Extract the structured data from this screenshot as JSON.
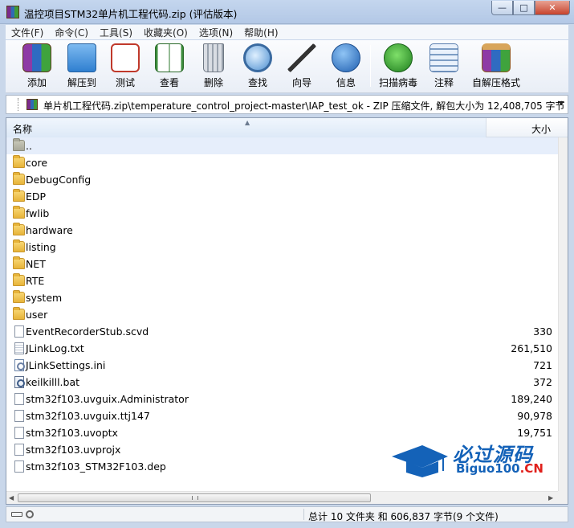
{
  "window": {
    "title": "温控项目STM32单片机工程代码.zip (评估版本)",
    "min_glyph": "—",
    "max_glyph": "□",
    "close_glyph": "✕"
  },
  "menu": [
    "文件(F)",
    "命令(C)",
    "工具(S)",
    "收藏夹(O)",
    "选项(N)",
    "帮助(H)"
  ],
  "toolbar": [
    {
      "label": "添加",
      "icon": "archive-add-icon"
    },
    {
      "label": "解压到",
      "icon": "extract-folder-icon"
    },
    {
      "label": "测试",
      "icon": "test-checklist-icon"
    },
    {
      "label": "查看",
      "icon": "view-book-icon"
    },
    {
      "label": "删除",
      "icon": "trash-icon"
    },
    {
      "label": "查找",
      "icon": "find-magnifier-icon"
    },
    {
      "label": "向导",
      "icon": "wizard-wand-icon"
    },
    {
      "label": "信息",
      "icon": "info-icon"
    },
    {
      "label": "扫描病毒",
      "icon": "virus-scan-bug-icon"
    },
    {
      "label": "注释",
      "icon": "comment-icon"
    },
    {
      "label": "自解压格式",
      "icon": "sfx-box-icon"
    }
  ],
  "address": {
    "path": "单片机工程代码.zip\\temperature_control_project-master\\IAP_test_ok - ZIP 压缩文件, 解包大小为 12,408,705 字节"
  },
  "columns": {
    "name": "名称",
    "size": "大小"
  },
  "files": [
    {
      "name": "..",
      "size": "",
      "type": "up"
    },
    {
      "name": "core",
      "size": "",
      "type": "folder"
    },
    {
      "name": "DebugConfig",
      "size": "",
      "type": "folder"
    },
    {
      "name": "EDP",
      "size": "",
      "type": "folder"
    },
    {
      "name": "fwlib",
      "size": "",
      "type": "folder"
    },
    {
      "name": "hardware",
      "size": "",
      "type": "folder"
    },
    {
      "name": "listing",
      "size": "",
      "type": "folder"
    },
    {
      "name": "NET",
      "size": "",
      "type": "folder"
    },
    {
      "name": "RTE",
      "size": "",
      "type": "folder"
    },
    {
      "name": "system",
      "size": "",
      "type": "folder"
    },
    {
      "name": "user",
      "size": "",
      "type": "folder"
    },
    {
      "name": "EventRecorderStub.scvd",
      "size": "330",
      "type": "doc"
    },
    {
      "name": "JLinkLog.txt",
      "size": "261,510",
      "type": "txt"
    },
    {
      "name": "JLinkSettings.ini",
      "size": "721",
      "type": "ini"
    },
    {
      "name": "keilkilll.bat",
      "size": "372",
      "type": "bat"
    },
    {
      "name": "stm32f103.uvguix.Administrator",
      "size": "189,240",
      "type": "doc"
    },
    {
      "name": "stm32f103.uvguix.ttj147",
      "size": "90,978",
      "type": "doc"
    },
    {
      "name": "stm32f103.uvoptx",
      "size": "19,751",
      "type": "doc"
    },
    {
      "name": "stm32f103.uvprojx",
      "size": "",
      "type": "doc"
    },
    {
      "name": "stm32f103_STM32F103.dep",
      "size": "",
      "type": "doc"
    }
  ],
  "status": {
    "summary": "总计 10 文件夹 和 606,837 字节(9 个文件)"
  },
  "watermark": {
    "title": "必过源码",
    "sub_main": "Biguo100",
    "sub_suffix": ".CN"
  }
}
